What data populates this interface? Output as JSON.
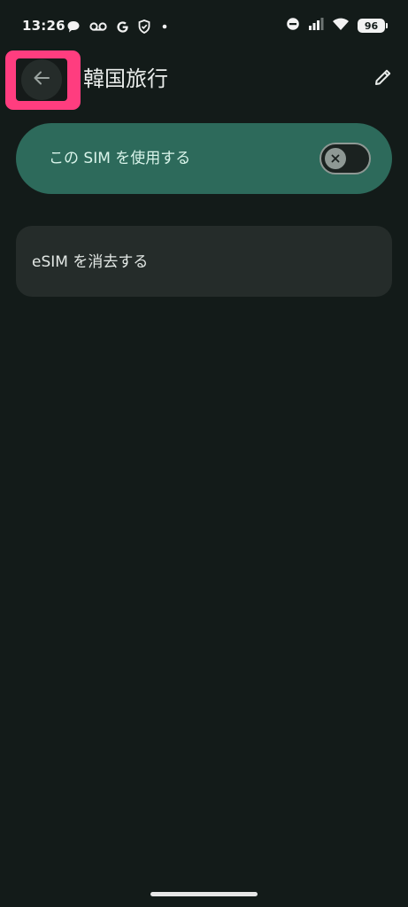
{
  "status_bar": {
    "time": "13:26",
    "battery_level": "96",
    "left_icons": [
      "chat-bubble-icon",
      "voicemail-icon",
      "google-icon",
      "shield-icon",
      "dot-icon"
    ],
    "right_icons": [
      "do-not-disturb-icon",
      "cellular-signal-icon",
      "wifi-icon",
      "battery-icon"
    ]
  },
  "app_bar": {
    "title": "韓国旅行",
    "back_icon": "arrow-back-icon",
    "edit_icon": "pencil-icon",
    "back_highlight_color": "#ff3d7f"
  },
  "use_sim": {
    "label": "この SIM を使用する",
    "toggle_on": false,
    "card_color": "#2d6a5b"
  },
  "erase_esim": {
    "label": "eSIM を消去する"
  },
  "colors": {
    "background": "#131b19",
    "surface": "#252c2a",
    "accent_container": "#2d6a5b"
  }
}
